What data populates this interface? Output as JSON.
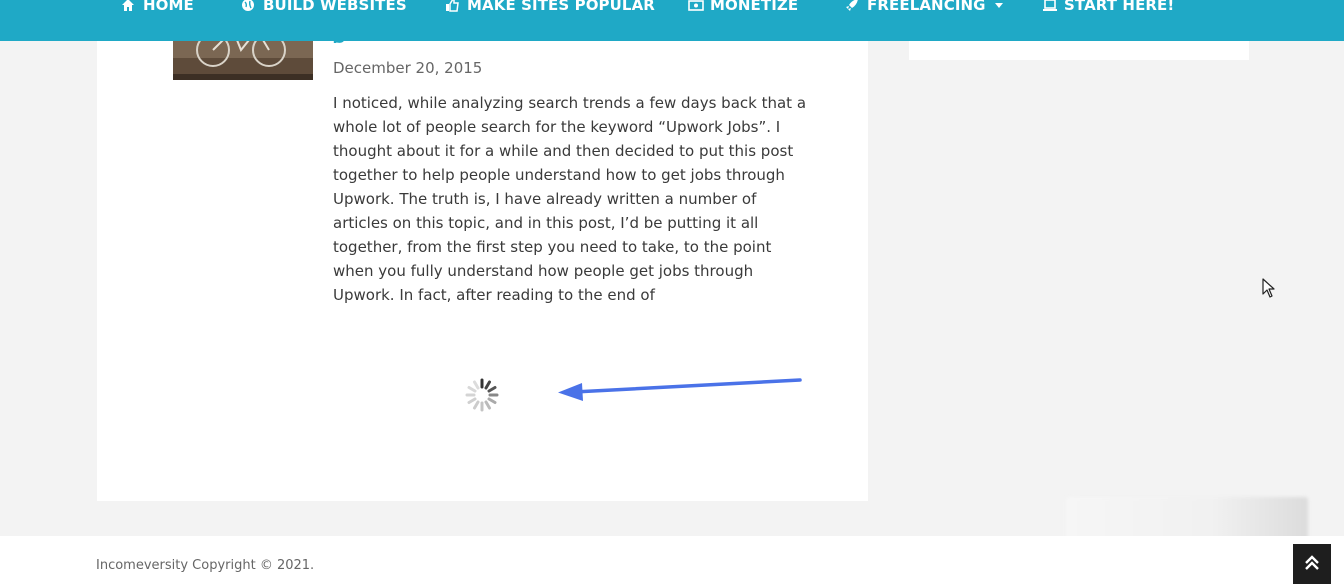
{
  "nav": {
    "items": [
      {
        "label": "HOME",
        "icon": "home-icon"
      },
      {
        "label": "BUILD WEBSITES",
        "icon": "globe-icon"
      },
      {
        "label": "MAKE SITES POPULAR",
        "icon": "thumbs-up-icon"
      },
      {
        "label": "MONETIZE",
        "icon": "money-icon"
      },
      {
        "label": "FREELANCING",
        "icon": "rocket-icon",
        "has_dropdown": true
      },
      {
        "label": "START HERE!",
        "icon": "laptop-icon"
      }
    ],
    "background": "#1fa9c6"
  },
  "post": {
    "date": "December 20, 2015",
    "excerpt": "I noticed, while analyzing search trends a few days back that a whole lot of people search for the keyword “Upwork Jobs”. I thought about it for a while and then decided to put this post together to help people understand how to get jobs through Upwork. The truth is, I have already written a number of articles on this topic, and in this post, I’d be putting it all together, from the first step you need to take, to the point when you fully understand how people get jobs through Upwork. In fact, after reading to the end of",
    "title_color": "#1fa9c6"
  },
  "loading": {
    "arrow_color": "#4a72e8"
  },
  "footer": {
    "copyright": "Incomeversity Copyright © 2021."
  }
}
